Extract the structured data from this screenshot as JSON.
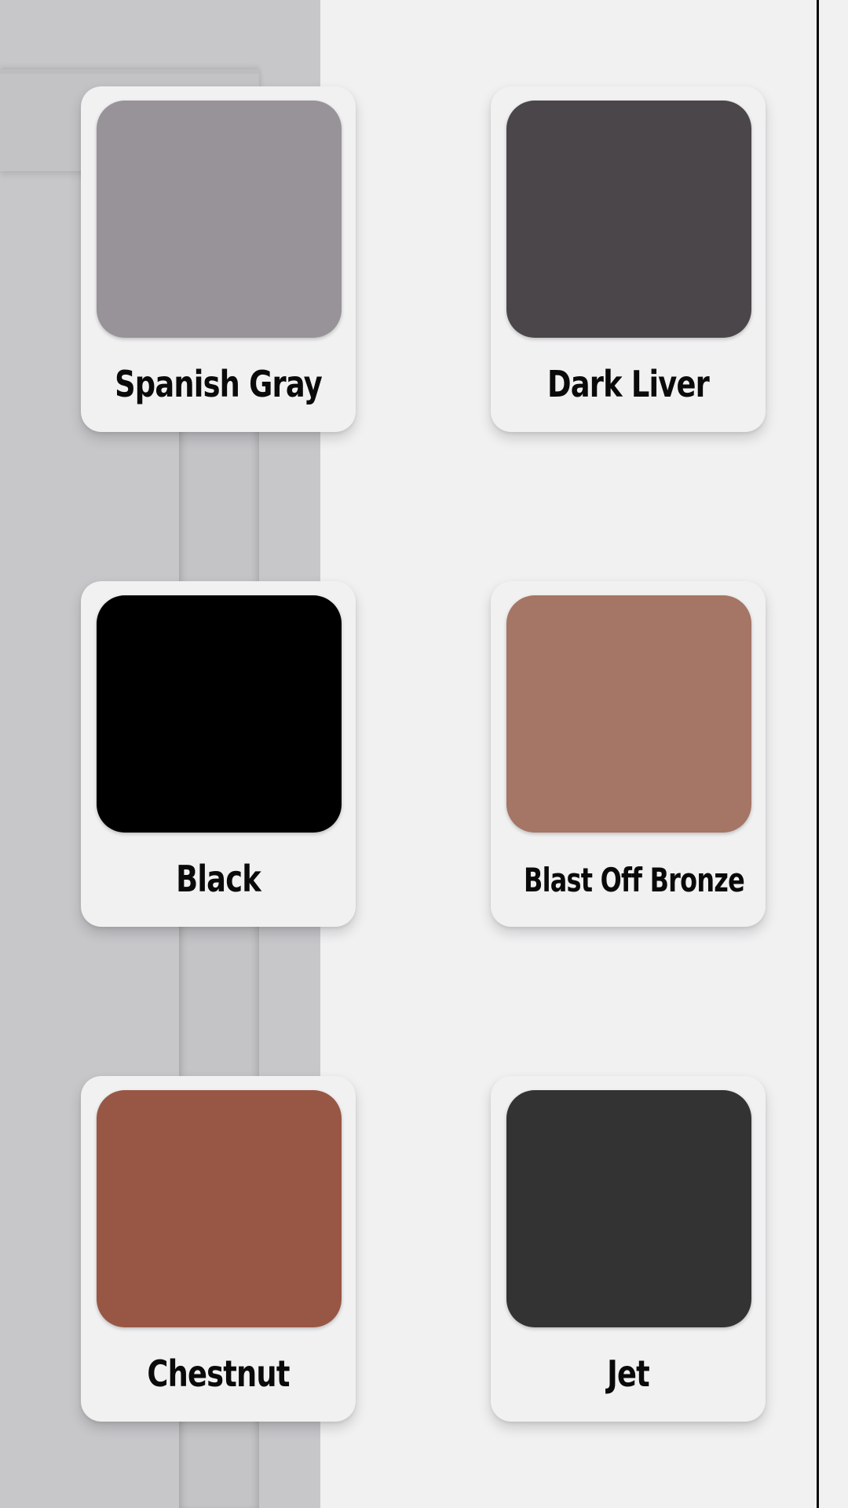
{
  "colors": [
    {
      "name": "Spanish Gray",
      "hex": "#989398"
    },
    {
      "name": "Dark Liver",
      "hex": "#4a4649"
    },
    {
      "name": "Black",
      "hex": "#000000"
    },
    {
      "name": "Blast Off Bronze",
      "hex": "#a57565"
    },
    {
      "name": "Chestnut",
      "hex": "#985744"
    },
    {
      "name": "Jet",
      "hex": "#333333"
    }
  ]
}
